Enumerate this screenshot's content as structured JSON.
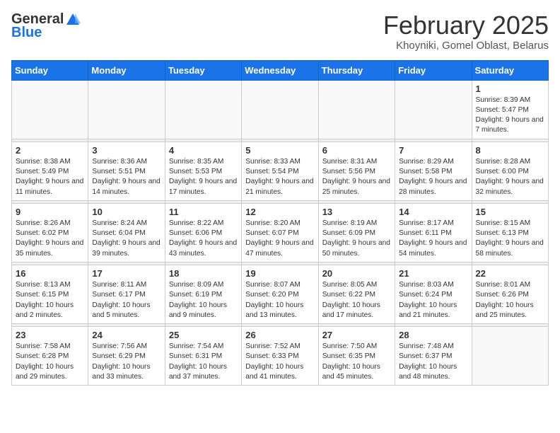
{
  "header": {
    "logo_general": "General",
    "logo_blue": "Blue",
    "month_title": "February 2025",
    "location": "Khoyniki, Gomel Oblast, Belarus"
  },
  "weekdays": [
    "Sunday",
    "Monday",
    "Tuesday",
    "Wednesday",
    "Thursday",
    "Friday",
    "Saturday"
  ],
  "weeks": [
    [
      {
        "day": "",
        "info": ""
      },
      {
        "day": "",
        "info": ""
      },
      {
        "day": "",
        "info": ""
      },
      {
        "day": "",
        "info": ""
      },
      {
        "day": "",
        "info": ""
      },
      {
        "day": "",
        "info": ""
      },
      {
        "day": "1",
        "info": "Sunrise: 8:39 AM\nSunset: 5:47 PM\nDaylight: 9 hours and 7 minutes."
      }
    ],
    [
      {
        "day": "2",
        "info": "Sunrise: 8:38 AM\nSunset: 5:49 PM\nDaylight: 9 hours and 11 minutes."
      },
      {
        "day": "3",
        "info": "Sunrise: 8:36 AM\nSunset: 5:51 PM\nDaylight: 9 hours and 14 minutes."
      },
      {
        "day": "4",
        "info": "Sunrise: 8:35 AM\nSunset: 5:53 PM\nDaylight: 9 hours and 17 minutes."
      },
      {
        "day": "5",
        "info": "Sunrise: 8:33 AM\nSunset: 5:54 PM\nDaylight: 9 hours and 21 minutes."
      },
      {
        "day": "6",
        "info": "Sunrise: 8:31 AM\nSunset: 5:56 PM\nDaylight: 9 hours and 25 minutes."
      },
      {
        "day": "7",
        "info": "Sunrise: 8:29 AM\nSunset: 5:58 PM\nDaylight: 9 hours and 28 minutes."
      },
      {
        "day": "8",
        "info": "Sunrise: 8:28 AM\nSunset: 6:00 PM\nDaylight: 9 hours and 32 minutes."
      }
    ],
    [
      {
        "day": "9",
        "info": "Sunrise: 8:26 AM\nSunset: 6:02 PM\nDaylight: 9 hours and 35 minutes."
      },
      {
        "day": "10",
        "info": "Sunrise: 8:24 AM\nSunset: 6:04 PM\nDaylight: 9 hours and 39 minutes."
      },
      {
        "day": "11",
        "info": "Sunrise: 8:22 AM\nSunset: 6:06 PM\nDaylight: 9 hours and 43 minutes."
      },
      {
        "day": "12",
        "info": "Sunrise: 8:20 AM\nSunset: 6:07 PM\nDaylight: 9 hours and 47 minutes."
      },
      {
        "day": "13",
        "info": "Sunrise: 8:19 AM\nSunset: 6:09 PM\nDaylight: 9 hours and 50 minutes."
      },
      {
        "day": "14",
        "info": "Sunrise: 8:17 AM\nSunset: 6:11 PM\nDaylight: 9 hours and 54 minutes."
      },
      {
        "day": "15",
        "info": "Sunrise: 8:15 AM\nSunset: 6:13 PM\nDaylight: 9 hours and 58 minutes."
      }
    ],
    [
      {
        "day": "16",
        "info": "Sunrise: 8:13 AM\nSunset: 6:15 PM\nDaylight: 10 hours and 2 minutes."
      },
      {
        "day": "17",
        "info": "Sunrise: 8:11 AM\nSunset: 6:17 PM\nDaylight: 10 hours and 5 minutes."
      },
      {
        "day": "18",
        "info": "Sunrise: 8:09 AM\nSunset: 6:19 PM\nDaylight: 10 hours and 9 minutes."
      },
      {
        "day": "19",
        "info": "Sunrise: 8:07 AM\nSunset: 6:20 PM\nDaylight: 10 hours and 13 minutes."
      },
      {
        "day": "20",
        "info": "Sunrise: 8:05 AM\nSunset: 6:22 PM\nDaylight: 10 hours and 17 minutes."
      },
      {
        "day": "21",
        "info": "Sunrise: 8:03 AM\nSunset: 6:24 PM\nDaylight: 10 hours and 21 minutes."
      },
      {
        "day": "22",
        "info": "Sunrise: 8:01 AM\nSunset: 6:26 PM\nDaylight: 10 hours and 25 minutes."
      }
    ],
    [
      {
        "day": "23",
        "info": "Sunrise: 7:58 AM\nSunset: 6:28 PM\nDaylight: 10 hours and 29 minutes."
      },
      {
        "day": "24",
        "info": "Sunrise: 7:56 AM\nSunset: 6:29 PM\nDaylight: 10 hours and 33 minutes."
      },
      {
        "day": "25",
        "info": "Sunrise: 7:54 AM\nSunset: 6:31 PM\nDaylight: 10 hours and 37 minutes."
      },
      {
        "day": "26",
        "info": "Sunrise: 7:52 AM\nSunset: 6:33 PM\nDaylight: 10 hours and 41 minutes."
      },
      {
        "day": "27",
        "info": "Sunrise: 7:50 AM\nSunset: 6:35 PM\nDaylight: 10 hours and 45 minutes."
      },
      {
        "day": "28",
        "info": "Sunrise: 7:48 AM\nSunset: 6:37 PM\nDaylight: 10 hours and 48 minutes."
      },
      {
        "day": "",
        "info": ""
      }
    ]
  ]
}
